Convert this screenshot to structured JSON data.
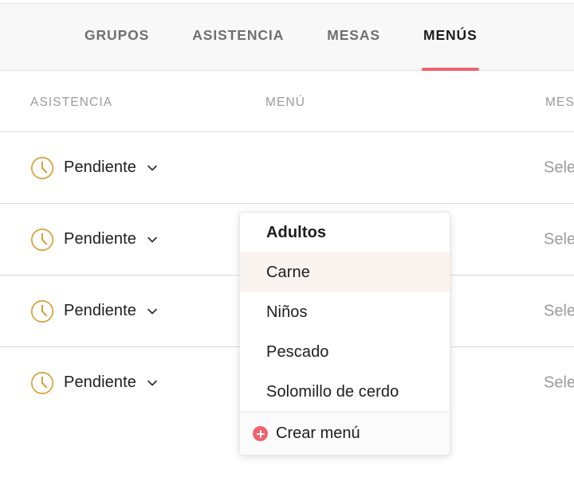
{
  "tabs": [
    {
      "label": "GRUPOS",
      "active": false
    },
    {
      "label": "ASISTENCIA",
      "active": false
    },
    {
      "label": "MESAS",
      "active": false
    },
    {
      "label": "MENÚS",
      "active": true
    }
  ],
  "table": {
    "headers": {
      "asistencia": "ASISTENCIA",
      "menu": "MENÚ",
      "mesa": "MES"
    },
    "rows": [
      {
        "asistencia": "Pendiente",
        "menu": "",
        "mesa": "Sele"
      },
      {
        "asistencia": "Pendiente",
        "menu": "",
        "mesa": "Sele"
      },
      {
        "asistencia": "Pendiente",
        "menu": "",
        "mesa": "Sele"
      },
      {
        "asistencia": "Pendiente",
        "menu": "",
        "mesa": "Sele"
      }
    ]
  },
  "dropdown": {
    "items": [
      {
        "label": "Adultos",
        "selected": true,
        "highlighted": false
      },
      {
        "label": "Carne",
        "selected": false,
        "highlighted": true
      },
      {
        "label": "Niños",
        "selected": false,
        "highlighted": false
      },
      {
        "label": "Pescado",
        "selected": false,
        "highlighted": false
      },
      {
        "label": "Solomillo de cerdo",
        "selected": false,
        "highlighted": false
      }
    ],
    "footer_label": "Crear menú"
  },
  "icons": {
    "status": "clock-icon",
    "expand": "chevron-down-icon",
    "create": "plus-circle-icon"
  },
  "colors": {
    "accent": "#f0626e",
    "status_clock": "#d79a2b",
    "highlight_row": "#faf4f1",
    "tabbar_bg": "#f8f8f8",
    "muted_text": "#9b9b9b"
  }
}
